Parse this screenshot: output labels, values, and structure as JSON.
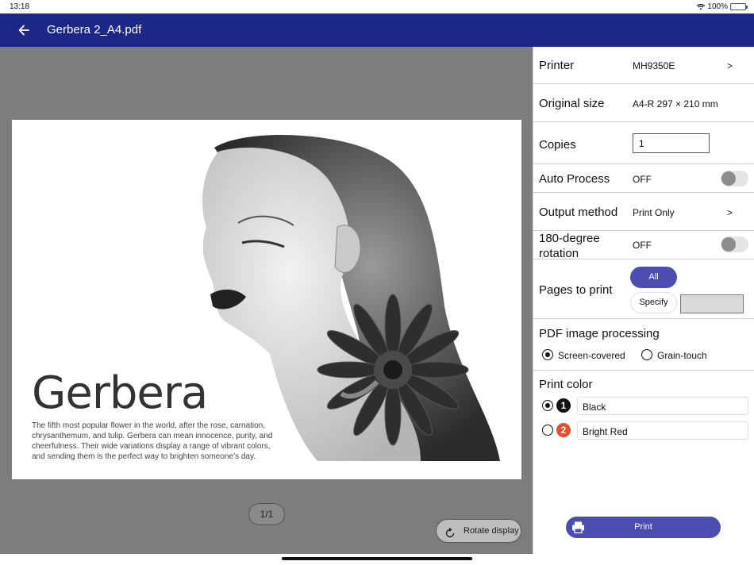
{
  "status": {
    "time": "13:18",
    "battery": "100%"
  },
  "appbar": {
    "title": "Gerbera 2_A4.pdf"
  },
  "preview": {
    "headline": "Gerbera",
    "body": "The fifth most popular flower in the world, after the rose, carnation, chrysanthemum, and tulip. Gerbera can mean innocence, purity, and cheerfulness. Their wide variations display a range of vibrant colors, and sending them is the perfect way to brighten someone’s day.",
    "page_indicator": "1/1",
    "rotate_label": "Rotate display"
  },
  "settings": {
    "printer": {
      "label": "Printer",
      "value": "MH9350E",
      "chevron": ">"
    },
    "original_size": {
      "label": "Original size",
      "value": "A4-R 297 × 210 mm"
    },
    "copies": {
      "label": "Copies",
      "value": "1"
    },
    "auto_process": {
      "label": "Auto Process",
      "value": "OFF"
    },
    "output_method": {
      "label": "Output method",
      "value": "Print Only",
      "chevron": ">"
    },
    "rotation": {
      "label": "180-degree rotation",
      "value": "OFF"
    },
    "pages": {
      "label": "Pages to print",
      "all": "All",
      "specify": "Specify"
    },
    "pdf_processing": {
      "label": "PDF image processing",
      "opt1": "Screen-covered",
      "opt2": "Grain-touch"
    },
    "print_color": {
      "label": "Print color",
      "color1_num": "1",
      "color1": "Black",
      "color2_num": "2",
      "color2": "Bright Red"
    }
  },
  "print_button": "Print",
  "colors": {
    "appbar": "#1d2788",
    "accent": "#4b4db0",
    "red": "#e2512b"
  }
}
